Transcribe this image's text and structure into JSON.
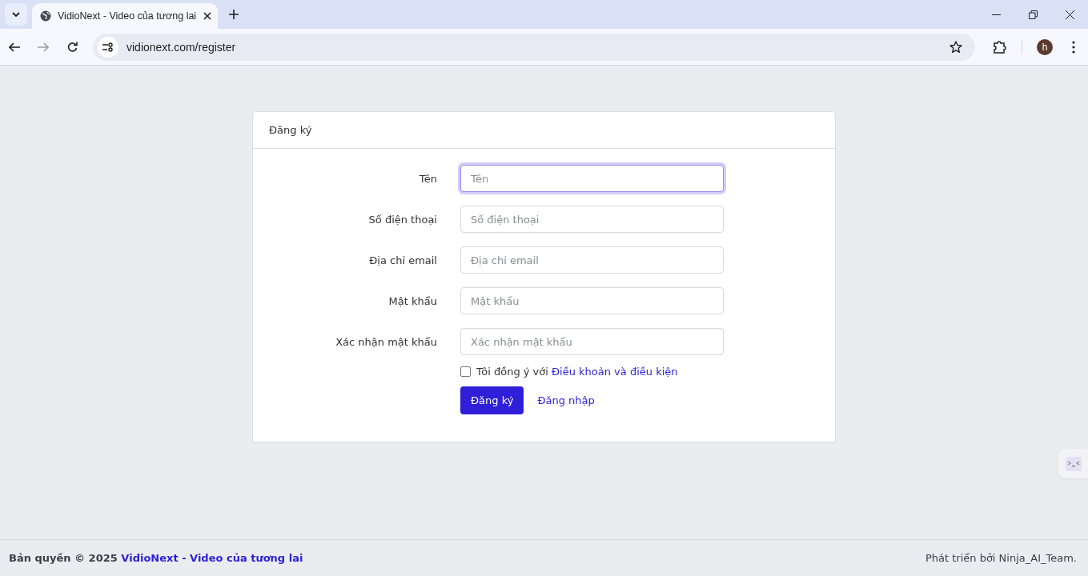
{
  "browser": {
    "tab_title": "VidioNext - Video của tương lai",
    "url": "vidionext.com/register",
    "avatar_letter": "h"
  },
  "card": {
    "title": "Đăng ký",
    "fields": [
      {
        "label": "Tên",
        "placeholder": "Tên",
        "focused": true
      },
      {
        "label": "Số điện thoại",
        "placeholder": "Số điện thoại",
        "focused": false
      },
      {
        "label": "Địa chỉ email",
        "placeholder": "Địa chỉ email",
        "focused": false
      },
      {
        "label": "Mật khẩu",
        "placeholder": "Mật khẩu",
        "focused": false
      },
      {
        "label": "Xác nhận mật khẩu",
        "placeholder": "Xác nhận mật khẩu",
        "focused": false
      }
    ],
    "terms": {
      "checked": false,
      "text": "Tôi đồng ý với",
      "link": "Điều khoản và điều kiện"
    },
    "submit": "Đăng ký",
    "login_link": "Đăng nhập"
  },
  "footer": {
    "copyright": "Bản quyền © 2025",
    "brand": "VidioNext - Video của tương lai",
    "credit": "Phát triển bởi Ninja_AI_Team."
  }
}
